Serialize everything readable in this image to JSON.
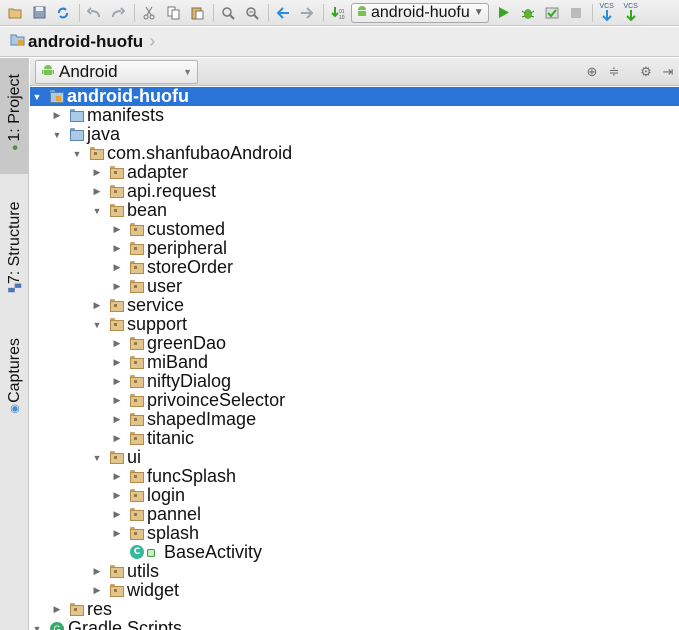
{
  "toolbar": {
    "run_config_label": "android-huofu",
    "vcs_label_1": "VCS",
    "vcs_label_2": "VCS",
    "icons": [
      "open-icon",
      "save-icon",
      "sync-icon",
      "undo-icon",
      "redo-icon",
      "cut-icon",
      "copy-icon",
      "paste-icon",
      "find-icon",
      "replace-icon",
      "back-icon",
      "forward-icon",
      "make-icon",
      "run-icon",
      "debug-icon",
      "coverage-icon",
      "stop-icon",
      "vcs-update-icon",
      "vcs-commit-icon"
    ]
  },
  "breadcrumb": {
    "project_label": "android-huofu"
  },
  "side_tabs": {
    "project_label": "1: Project",
    "structure_label": "7: Structure",
    "captures_label": "Captures"
  },
  "project_view": {
    "selected_view": "Android"
  },
  "tree": [
    {
      "label": "android-huofu",
      "depth": 0,
      "expanded": true,
      "icon": "module-folder",
      "selected": true
    },
    {
      "label": "manifests",
      "depth": 1,
      "expanded": false,
      "icon": "blue-folder"
    },
    {
      "label": "java",
      "depth": 1,
      "expanded": true,
      "icon": "blue-folder"
    },
    {
      "label": "com.shanfubaoAndroid",
      "depth": 2,
      "expanded": true,
      "icon": "package"
    },
    {
      "label": "adapter",
      "depth": 3,
      "expanded": false,
      "icon": "package"
    },
    {
      "label": "api.request",
      "depth": 3,
      "expanded": false,
      "icon": "package"
    },
    {
      "label": "bean",
      "depth": 3,
      "expanded": true,
      "icon": "package"
    },
    {
      "label": "customed",
      "depth": 4,
      "expanded": false,
      "icon": "package"
    },
    {
      "label": "peripheral",
      "depth": 4,
      "expanded": false,
      "icon": "package"
    },
    {
      "label": "storeOrder",
      "depth": 4,
      "expanded": false,
      "icon": "package"
    },
    {
      "label": "user",
      "depth": 4,
      "expanded": false,
      "icon": "package"
    },
    {
      "label": "service",
      "depth": 3,
      "expanded": false,
      "icon": "package"
    },
    {
      "label": "support",
      "depth": 3,
      "expanded": true,
      "icon": "package"
    },
    {
      "label": "greenDao",
      "depth": 4,
      "expanded": false,
      "icon": "package"
    },
    {
      "label": "miBand",
      "depth": 4,
      "expanded": false,
      "icon": "package"
    },
    {
      "label": "niftyDialog",
      "depth": 4,
      "expanded": false,
      "icon": "package"
    },
    {
      "label": "privoinceSelector",
      "depth": 4,
      "expanded": false,
      "icon": "package"
    },
    {
      "label": "shapedImage",
      "depth": 4,
      "expanded": false,
      "icon": "package"
    },
    {
      "label": "titanic",
      "depth": 4,
      "expanded": false,
      "icon": "package"
    },
    {
      "label": "ui",
      "depth": 3,
      "expanded": true,
      "icon": "package"
    },
    {
      "label": "funcSplash",
      "depth": 4,
      "expanded": false,
      "icon": "package"
    },
    {
      "label": "login",
      "depth": 4,
      "expanded": false,
      "icon": "package"
    },
    {
      "label": "pannel",
      "depth": 4,
      "expanded": false,
      "icon": "package"
    },
    {
      "label": "splash",
      "depth": 4,
      "expanded": false,
      "icon": "package"
    },
    {
      "label": "BaseActivity",
      "depth": 4,
      "expanded": null,
      "icon": "class"
    },
    {
      "label": "utils",
      "depth": 3,
      "expanded": false,
      "icon": "package"
    },
    {
      "label": "widget",
      "depth": 3,
      "expanded": false,
      "icon": "package"
    },
    {
      "label": "res",
      "depth": 1,
      "expanded": false,
      "icon": "res-folder"
    },
    {
      "label": "Gradle Scripts",
      "depth": 0,
      "expanded": true,
      "icon": "gradle"
    }
  ]
}
